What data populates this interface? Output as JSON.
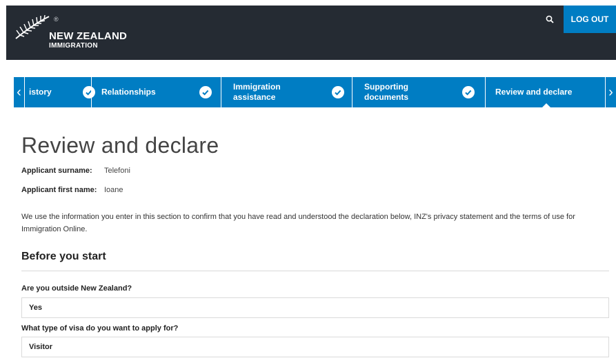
{
  "header": {
    "logo_line1": "NEW ZEALAND",
    "logo_line2": "IMMIGRATION",
    "logo_reg": "®",
    "logout_label": "LOG OUT",
    "search_icon": "search-icon",
    "bg_color": "#252b33",
    "accent_color": "#007dc3"
  },
  "steps": {
    "prev_icon": "‹",
    "next_icon": "›",
    "items": [
      {
        "label": "istory",
        "done": true
      },
      {
        "label": "Relationships",
        "done": true
      },
      {
        "label_line1": "Immigration",
        "label_line2": "assistance",
        "done": true
      },
      {
        "label_line1": "Supporting",
        "label_line2": "documents",
        "done": true
      },
      {
        "label": "Review and declare",
        "active": true
      }
    ]
  },
  "page": {
    "title": "Review and declare",
    "surname_label": "Applicant surname:",
    "surname_value": "Telefoni",
    "firstname_label": "Applicant first name:",
    "firstname_value": "Ioane",
    "intro": "We use the information you enter in this section to confirm that you have read and understood the declaration below, INZ's privacy statement and the terms of use for Immigration Online."
  },
  "before_start": {
    "title": "Before you start",
    "q1_label": "Are you outside New Zealand?",
    "q1_value": "Yes",
    "q2_label": "What type of visa do you want to apply for?",
    "q2_value": "Visitor"
  }
}
